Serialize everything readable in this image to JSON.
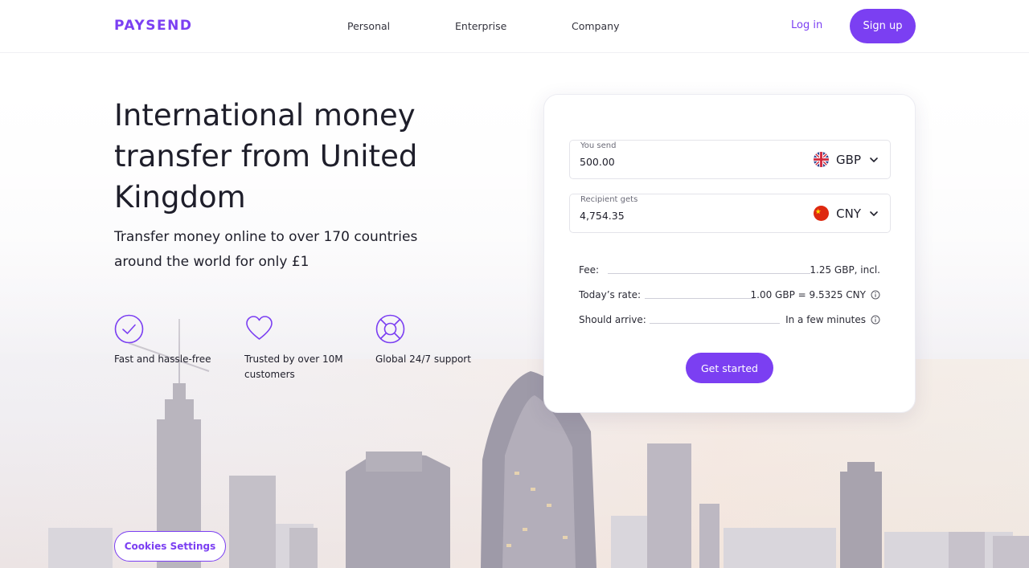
{
  "brand": {
    "logo": "PAYSEND",
    "accent": "#7b3ff2"
  },
  "nav": {
    "personal": "Personal",
    "enterprise": "Enterprise",
    "company": "Company",
    "login": "Log in",
    "signup": "Sign up"
  },
  "hero": {
    "title": "International money transfer from United Kingdom",
    "subtitle": "Transfer money online to over 170 countries around the world for only £1"
  },
  "features": [
    {
      "icon": "check-circle-icon",
      "text": "Fast and hassle-free"
    },
    {
      "icon": "heart-circle-icon",
      "text": "Trusted by over 10M customers"
    },
    {
      "icon": "lifebuoy-icon",
      "text": "Global 24/7 support"
    }
  ],
  "calculator": {
    "send": {
      "label": "You send",
      "value": "500.00",
      "currency": "GBP",
      "flag": "uk-flag-icon"
    },
    "receive": {
      "label": "Recipient gets",
      "value": "4,754.35",
      "currency": "CNY",
      "flag": "china-flag-icon"
    },
    "fee": {
      "label": "Fee:",
      "value": "1.25 GBP, incl."
    },
    "rate": {
      "label": "Today’s rate:",
      "value": "1.00 GBP = 9.5325 CNY"
    },
    "arrive": {
      "label": "Should arrive:",
      "value": "In a few minutes"
    },
    "cta": "Get started"
  },
  "cookies": {
    "label": "Cookies Settings"
  }
}
